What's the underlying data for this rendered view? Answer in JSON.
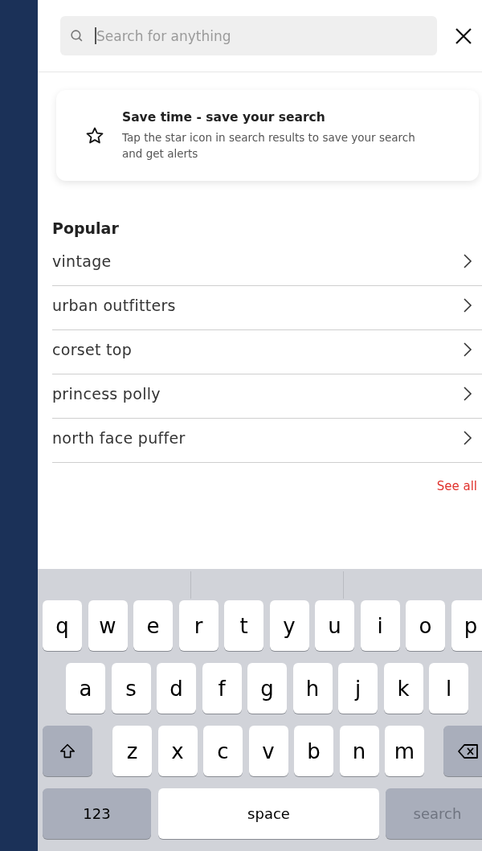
{
  "search": {
    "placeholder": "Search for anything",
    "focused": true
  },
  "promo": {
    "title": "Save time - save your search",
    "body": "Tap the star icon in search results to save your search and get alerts"
  },
  "popular": {
    "title": "Popular",
    "items": [
      "vintage",
      "urban outfitters",
      "corset top",
      "princess polly",
      "north face puffer"
    ],
    "see_all": "See all"
  },
  "keyboard": {
    "rows": [
      {
        "keys": [
          {
            "kind": "letter",
            "label": "q"
          },
          {
            "kind": "letter",
            "label": "w"
          },
          {
            "kind": "letter",
            "label": "e"
          },
          {
            "kind": "letter",
            "label": "r"
          },
          {
            "kind": "letter",
            "label": "t"
          },
          {
            "kind": "letter",
            "label": "y"
          },
          {
            "kind": "letter",
            "label": "u"
          },
          {
            "kind": "letter",
            "label": "i"
          },
          {
            "kind": "letter",
            "label": "o"
          },
          {
            "kind": "letter",
            "label": "p"
          }
        ]
      },
      {
        "keys": [
          {
            "kind": "letter",
            "label": "a"
          },
          {
            "kind": "letter",
            "label": "s"
          },
          {
            "kind": "letter",
            "label": "d"
          },
          {
            "kind": "letter",
            "label": "f"
          },
          {
            "kind": "letter",
            "label": "g"
          },
          {
            "kind": "letter",
            "label": "h"
          },
          {
            "kind": "letter",
            "label": "j"
          },
          {
            "kind": "letter",
            "label": "k"
          },
          {
            "kind": "letter",
            "label": "l"
          }
        ]
      },
      {
        "keys": [
          {
            "kind": "shift"
          },
          {
            "kind": "letter",
            "label": "z"
          },
          {
            "kind": "letter",
            "label": "x"
          },
          {
            "kind": "letter",
            "label": "c"
          },
          {
            "kind": "letter",
            "label": "v"
          },
          {
            "kind": "letter",
            "label": "b"
          },
          {
            "kind": "letter",
            "label": "n"
          },
          {
            "kind": "letter",
            "label": "m"
          },
          {
            "kind": "delete"
          }
        ]
      },
      {
        "keys": [
          {
            "kind": "mode",
            "label": "123"
          },
          {
            "kind": "space",
            "label": "space"
          },
          {
            "kind": "action",
            "label": "search",
            "disabled": true
          }
        ]
      }
    ]
  }
}
